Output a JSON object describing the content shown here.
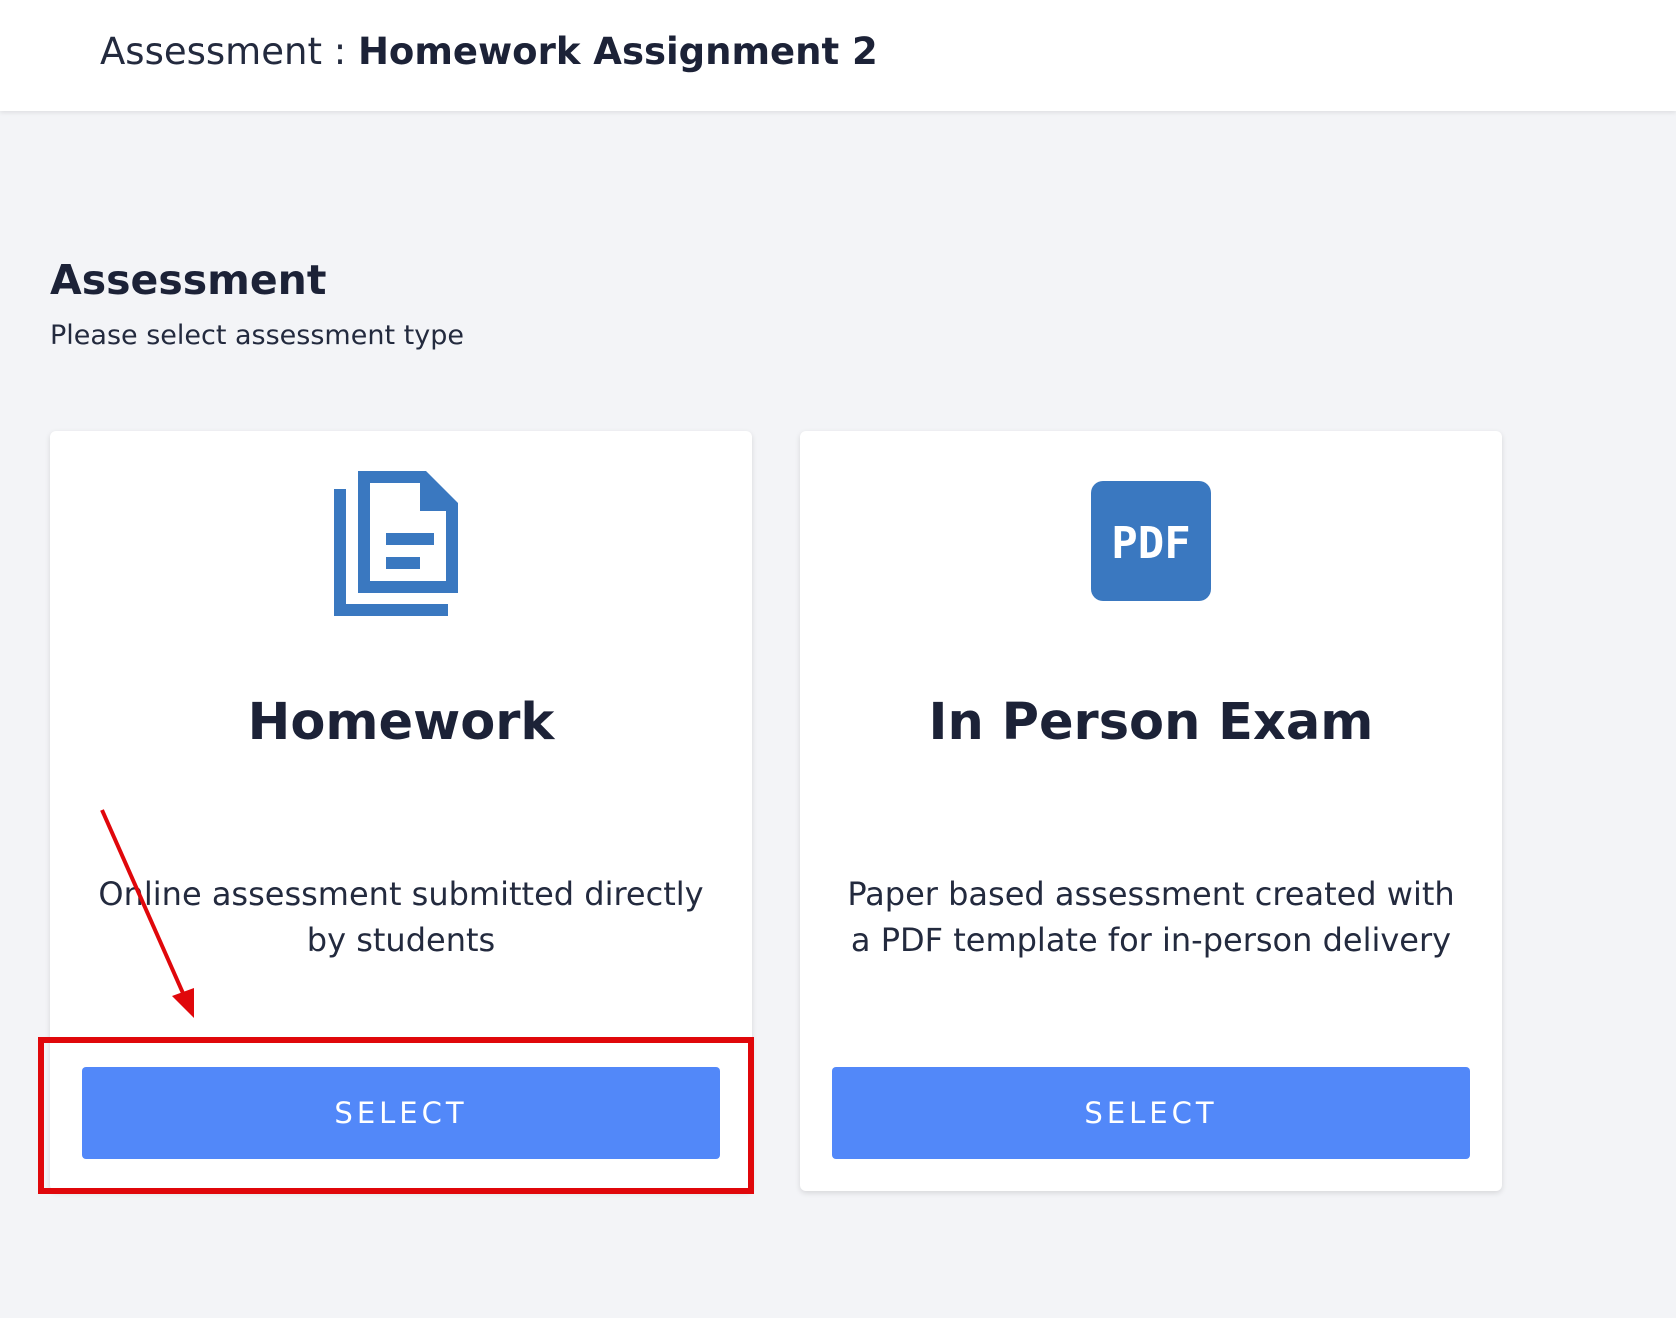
{
  "header": {
    "prefix": "Assessment : ",
    "assignment_name": "Homework Assignment 2"
  },
  "section": {
    "title": "Assessment",
    "subtitle": "Please select assessment type"
  },
  "cards": [
    {
      "icon": "document-copy-icon",
      "title": "Homework",
      "description": "Online assessment submitted directly by students",
      "button_label": "SELECT"
    },
    {
      "icon": "pdf-icon",
      "icon_text": "PDF",
      "title": "In Person Exam",
      "description": "Paper based assessment created with a PDF template for in-person delivery",
      "button_label": "SELECT"
    }
  ],
  "colors": {
    "accent_button": "#5288f9",
    "icon_blue": "#3a78c0",
    "annotation_red": "#e0070b",
    "background": "#f3f4f7"
  }
}
